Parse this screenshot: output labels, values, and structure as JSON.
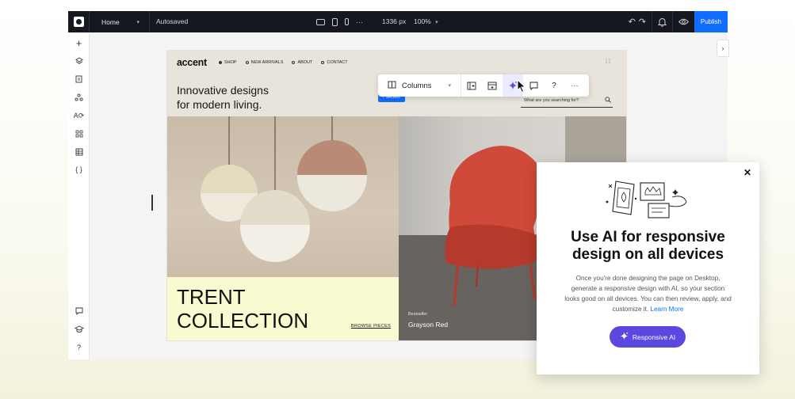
{
  "topbar": {
    "home_label": "Home",
    "autosaved": "Autosaved",
    "width": "1336 px",
    "zoom": "100%",
    "publish_label": "Publish"
  },
  "site": {
    "logo": "accent",
    "nav": [
      "SHOP",
      "NEW ARRIVALS",
      "ABOUT",
      "CONTACT"
    ],
    "hero_line1": "Innovative designs",
    "hero_line2": "for modern living.",
    "search_placeholder": "What are you searching for?",
    "section_tag": "Section",
    "collection_line1": "TRENT",
    "collection_line2": "COLLECTION",
    "browse": "BROWSE PIECES",
    "bestseller": "Bestseller",
    "product_name": "Grayson Red"
  },
  "floating_toolbar": {
    "layout_label": "Columns"
  },
  "popup": {
    "title_line1": "Use AI for responsive",
    "title_line2": "design on all devices",
    "body": "Once you're done designing the page on Desktop, generate a responsive design with AI, so your section looks good on all devices. You can then review, apply, and customize it.",
    "link": "Learn More",
    "button_label": "Responsive AI"
  }
}
